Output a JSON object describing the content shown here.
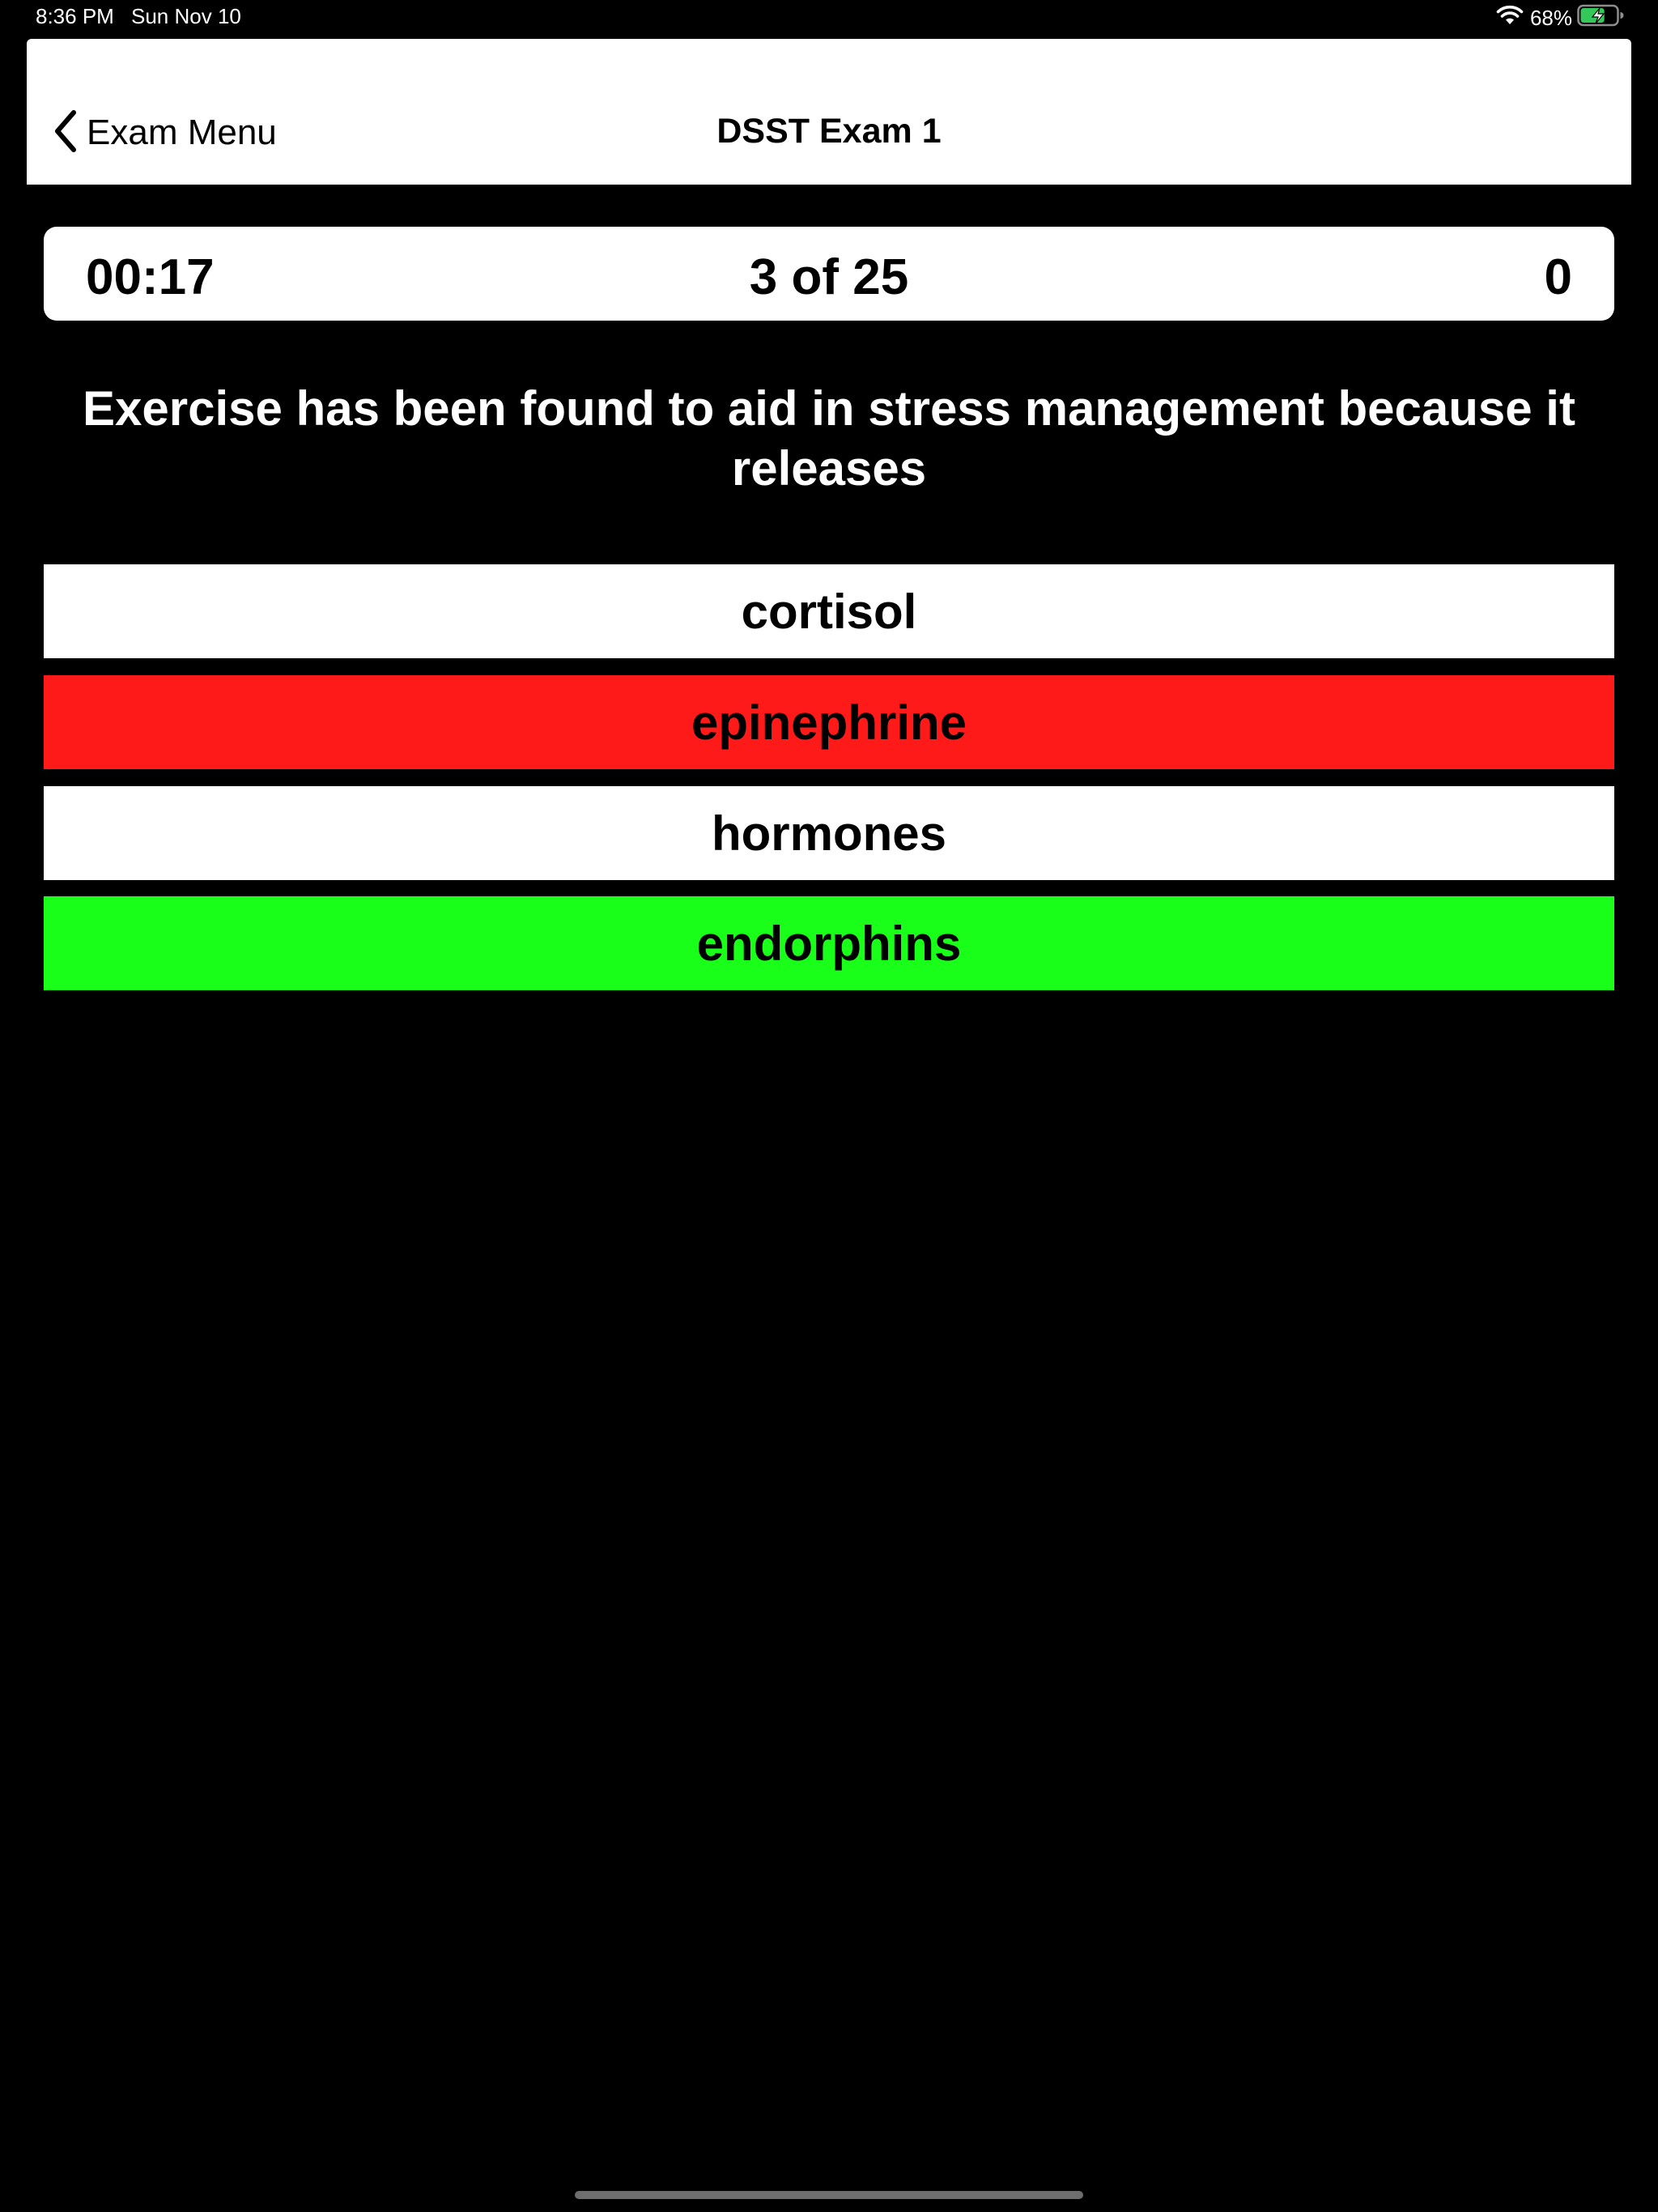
{
  "status_bar": {
    "time": "8:36 PM",
    "date": "Sun Nov 10",
    "battery_percent": "68%",
    "battery_level": 0.68,
    "battery_charging": true,
    "battery_color": "#34c759",
    "wifi_icon": "wifi-icon",
    "battery_icon": "battery-charging-icon"
  },
  "nav": {
    "back_icon": "chevron-left-icon",
    "back_label": "Exam Menu",
    "title": "DSST Exam 1"
  },
  "info_bar": {
    "timer": "00:17",
    "progress": "3 of 25",
    "score": "0"
  },
  "question": {
    "text": "Exercise has been found to aid in stress management because it releases"
  },
  "answers": [
    {
      "label": "cortisol",
      "state": "default",
      "color": "#ffffff"
    },
    {
      "label": "epinephrine",
      "state": "incorrect",
      "color": "#ff1a1a"
    },
    {
      "label": "hormones",
      "state": "default",
      "color": "#ffffff"
    },
    {
      "label": "endorphins",
      "state": "correct",
      "color": "#19ff19"
    }
  ],
  "colors": {
    "background": "#000000",
    "panel": "#ffffff",
    "incorrect": "#ff1a1a",
    "correct": "#19ff19"
  }
}
